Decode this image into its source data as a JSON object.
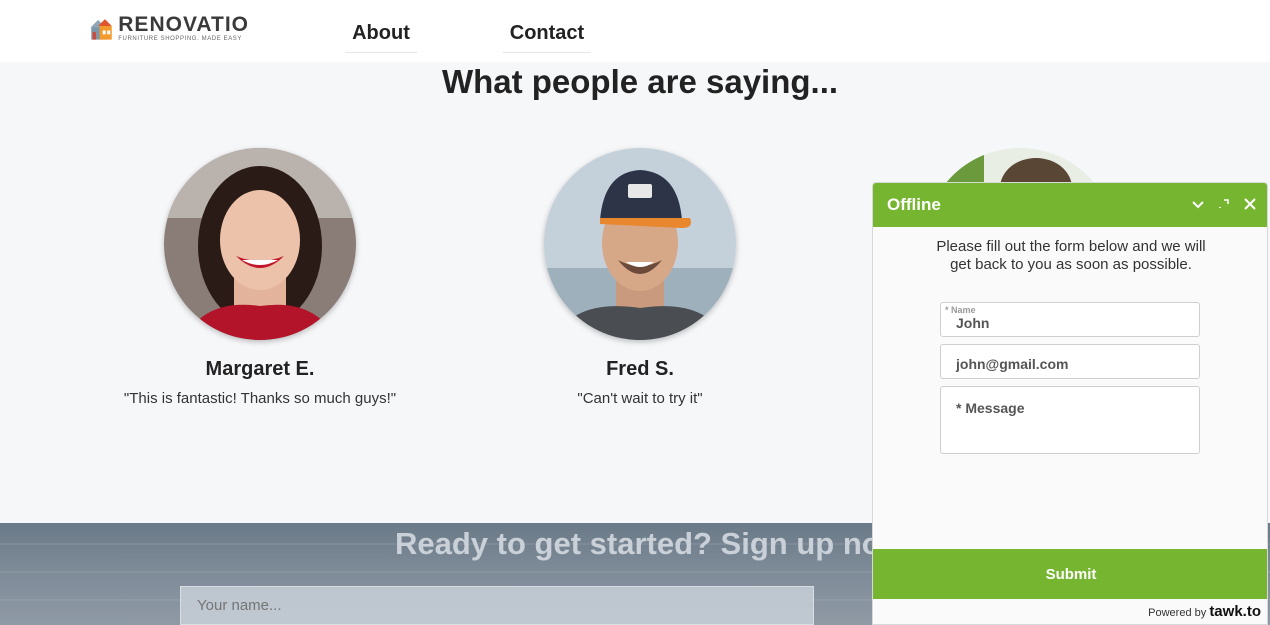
{
  "brand": {
    "name": "RENOVATIO",
    "tagline": "FURNITURE SHOPPING. MADE EASY"
  },
  "nav": {
    "about": "About",
    "contact": "Contact"
  },
  "testimonials": {
    "title": "What people are saying...",
    "items": [
      {
        "name": "Margaret E.",
        "quote": "\"This is fantastic! Thanks so much guys!\""
      },
      {
        "name": "Fred S.",
        "quote": "\"Can't wait to try it\""
      }
    ]
  },
  "signup": {
    "title": "Ready to get started? Sign up now",
    "name_placeholder": "Your name..."
  },
  "chat": {
    "status": "Offline",
    "message": "Please fill out the form below and we will get back to you as soon as possible.",
    "name_label": "* Name",
    "name_value": "John",
    "email_value": "john@gmail.com",
    "message_placeholder": "* Message",
    "submit_label": "Submit",
    "powered_by": "Powered by",
    "powered_brand": "tawk.to",
    "accent_color": "#76b52f"
  }
}
